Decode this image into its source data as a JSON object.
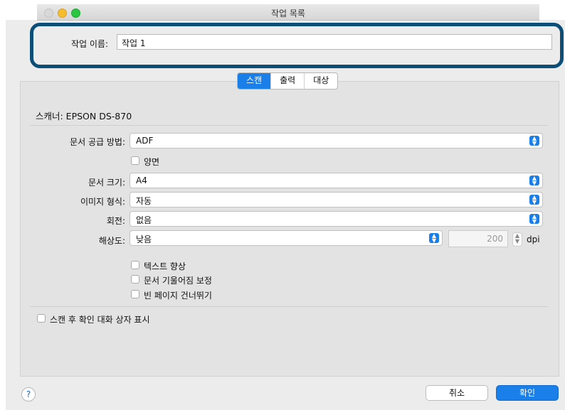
{
  "window": {
    "title": "작업 목록"
  },
  "job": {
    "name_label": "작업 이름:",
    "name_value": "작업 1"
  },
  "tabs": [
    {
      "label": "스캔",
      "active": true
    },
    {
      "label": "출력",
      "active": false
    },
    {
      "label": "대상",
      "active": false
    }
  ],
  "scanner": {
    "label": "스캐너: EPSON DS-870"
  },
  "settings": {
    "source": {
      "label": "문서 공급 방법:",
      "value": "ADF"
    },
    "duplex": {
      "label": "양면",
      "checked": false
    },
    "size": {
      "label": "문서 크기:",
      "value": "A4"
    },
    "image_type": {
      "label": "이미지 형식:",
      "value": "자동"
    },
    "rotation": {
      "label": "회전:",
      "value": "없음"
    },
    "resolution": {
      "label": "해상도:",
      "value": "낮음",
      "dpi": "200",
      "unit": "dpi"
    }
  },
  "options": [
    {
      "label": "텍스트 향상",
      "checked": false
    },
    {
      "label": "문서 기울어짐 보정",
      "checked": false
    },
    {
      "label": "빈 페이지 건너뛰기",
      "checked": false
    }
  ],
  "confirm_dialog": {
    "label": "스캔 후 확인 대화 상자 표시",
    "checked": false
  },
  "buttons": {
    "cancel": "취소",
    "ok": "확인",
    "help": "?"
  },
  "colors": {
    "accent": "#1a7fe9",
    "highlight_border": "#0b4f78"
  }
}
